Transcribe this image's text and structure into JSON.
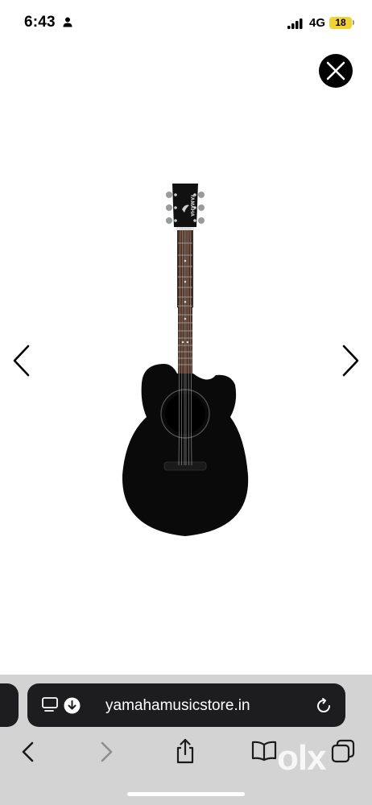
{
  "status_bar": {
    "time": "6:43",
    "network": "4G",
    "battery_level": "18",
    "battery_color": "#f2d22e"
  },
  "viewer": {
    "close_icon": "close-icon",
    "prev_icon": "chevron-left-icon",
    "next_icon": "chevron-right-icon",
    "image": {
      "headstock_brand": "YAMAHA"
    }
  },
  "browser": {
    "url": "yamahamusicstore.in",
    "chrome_color": "#d3d3d3",
    "address_bar_color": "#1d1d1f",
    "toolbar_icons": [
      "back-icon",
      "forward-icon",
      "share-icon",
      "bookmarks-icon",
      "tabs-icon"
    ]
  },
  "watermark": {
    "text": "olx"
  }
}
